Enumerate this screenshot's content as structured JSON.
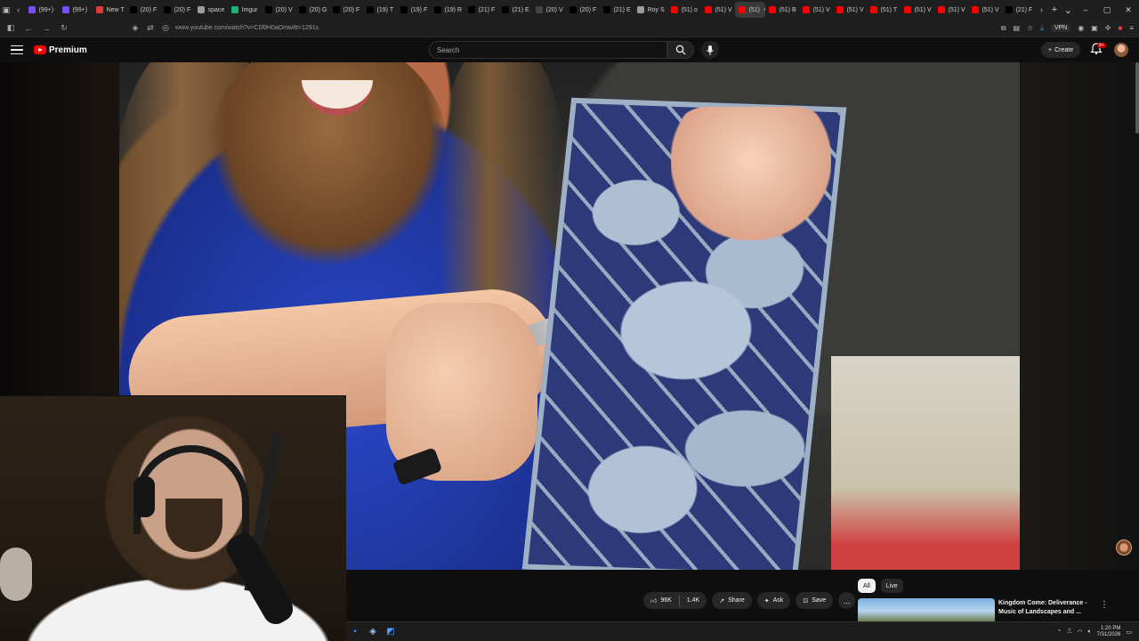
{
  "browser": {
    "tabs": [
      {
        "label": "(99+)",
        "color": "#7c4dff"
      },
      {
        "label": "(99+)",
        "color": "#7c4dff"
      },
      {
        "label": "New T",
        "color": "#e53935"
      },
      {
        "label": "(20) F",
        "color": "#000000"
      },
      {
        "label": "(20) F",
        "color": "#000000"
      },
      {
        "label": "space",
        "color": "#9e9e9e"
      },
      {
        "label": "Imgur",
        "color": "#1bb76e"
      },
      {
        "label": "(20) V",
        "color": "#000000"
      },
      {
        "label": "(20) G",
        "color": "#000000"
      },
      {
        "label": "(20) F",
        "color": "#000000"
      },
      {
        "label": "(19) T",
        "color": "#000000"
      },
      {
        "label": "(19) F",
        "color": "#000000"
      },
      {
        "label": "(19) R",
        "color": "#000000"
      },
      {
        "label": "(21) F",
        "color": "#000000"
      },
      {
        "label": "(21) E",
        "color": "#000000"
      },
      {
        "label": "(20) V",
        "color": "#444444"
      },
      {
        "label": "(20) F",
        "color": "#000000"
      },
      {
        "label": "(21) E",
        "color": "#000000"
      },
      {
        "label": "Roy S",
        "color": "#9e9e9e"
      },
      {
        "label": "(51) o",
        "color": "#ff0000"
      },
      {
        "label": "(51) V",
        "color": "#ff0000"
      },
      {
        "label": "(51)",
        "color": "#ff0000",
        "active": true
      },
      {
        "label": "(51) B",
        "color": "#ff0000"
      },
      {
        "label": "(51) V",
        "color": "#ff0000"
      },
      {
        "label": "(51) V",
        "color": "#ff0000"
      },
      {
        "label": "(51) T",
        "color": "#ff0000"
      },
      {
        "label": "(51) V",
        "color": "#ff0000"
      },
      {
        "label": "(51) V",
        "color": "#ff0000"
      },
      {
        "label": "(51) V",
        "color": "#ff0000"
      },
      {
        "label": "(21) F",
        "color": "#000000"
      }
    ],
    "url": "www.youtube.com/watch?v=C0l9H0aOmw8t=1291s",
    "vpn_label": "VPN"
  },
  "masthead": {
    "logo_text": "Premium",
    "search_placeholder": "Search",
    "create_label": "Create",
    "notif_badge": "9+"
  },
  "actions": {
    "likes": "96K",
    "comments_count": "1.4K",
    "share_label": "Share",
    "ask_label": "Ask",
    "save_label": "Save",
    "more_label": "..."
  },
  "sidebar": {
    "chips": [
      "All",
      "Live"
    ],
    "recommendation": {
      "title": "Kingdom Come: Deliverance - Music of Landscapes and ..."
    }
  },
  "taskbar": {
    "time": "1:20 PM",
    "date": "7/31/2026"
  },
  "colors": {
    "youtube_red": "#ff0000",
    "background": "#0f0f0f",
    "pill": "#272727"
  }
}
